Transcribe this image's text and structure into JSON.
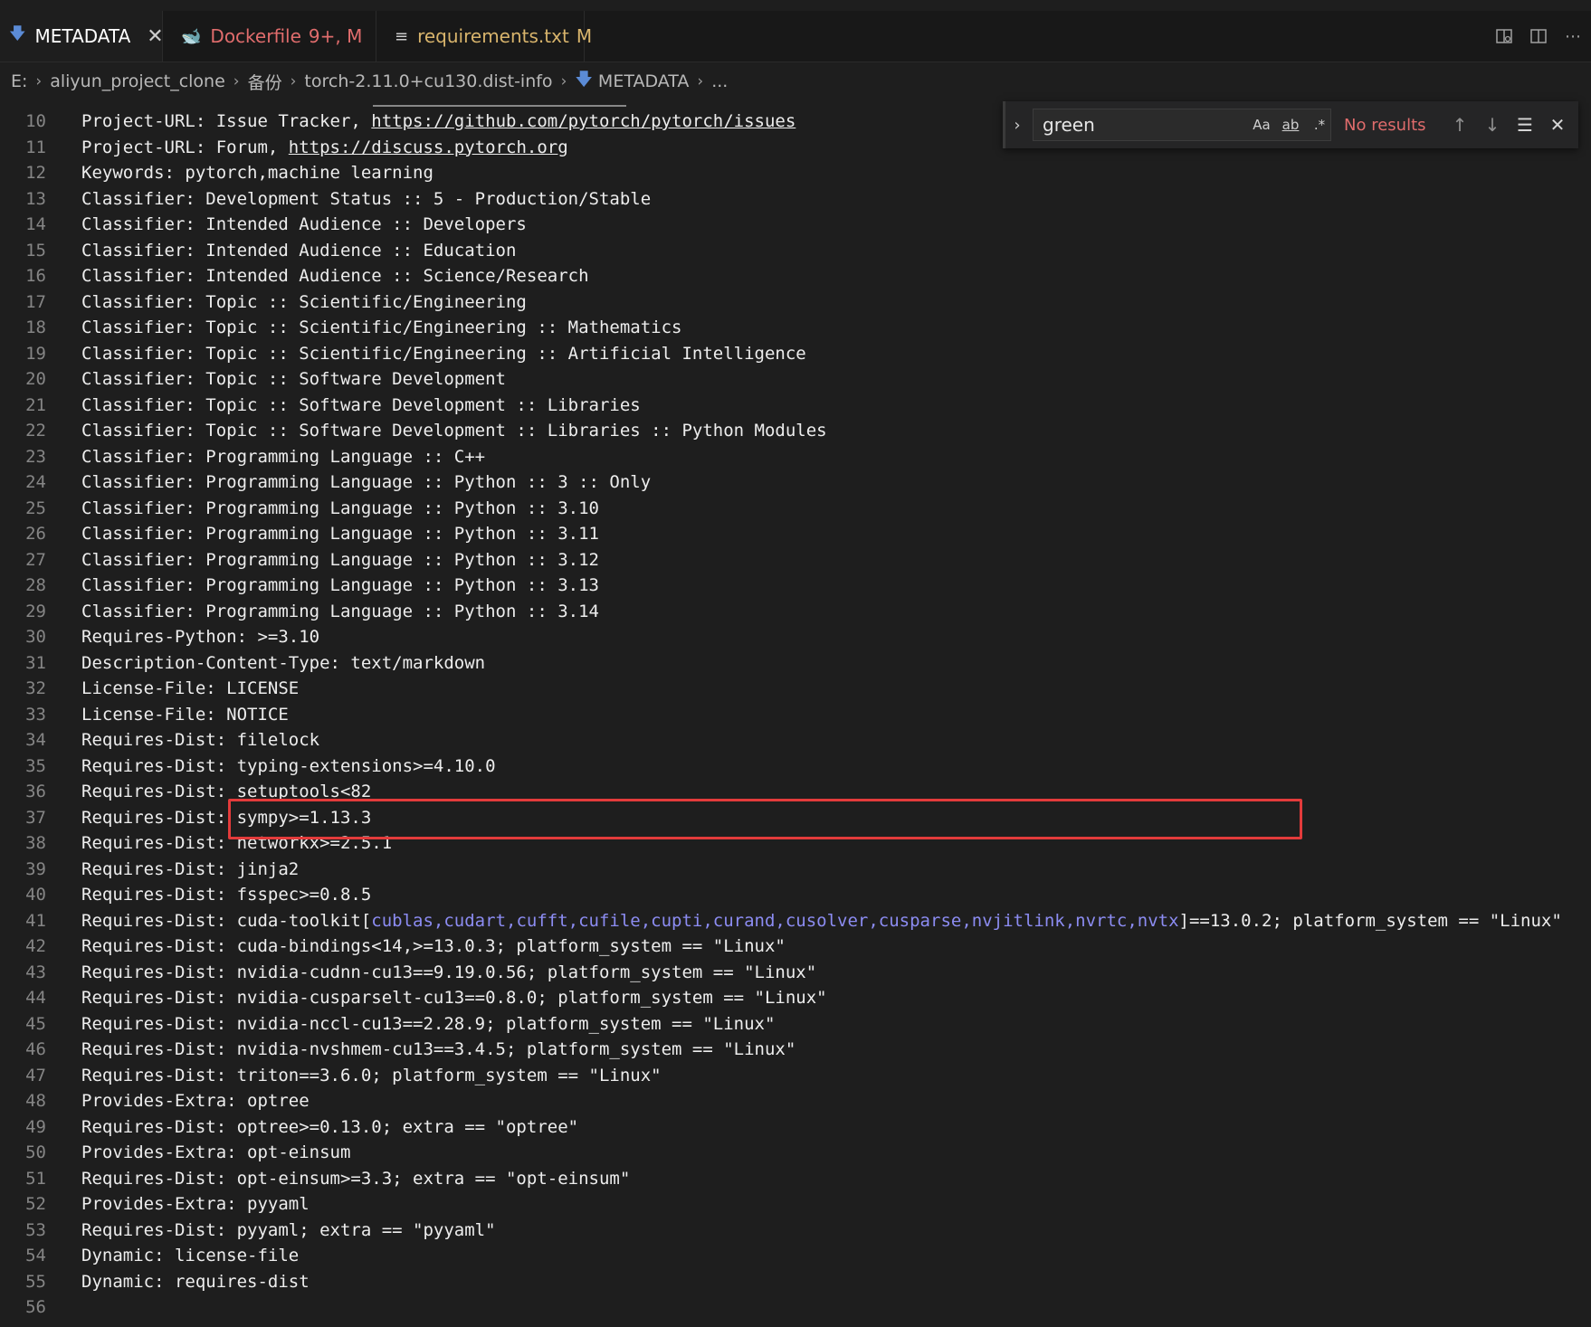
{
  "tabs": [
    {
      "label": "METADATA",
      "icon": "metadata-icon",
      "badge": "",
      "close": "✕"
    },
    {
      "label": "Dockerfile",
      "icon": "docker-icon",
      "badge": "9+, M",
      "close": ""
    },
    {
      "label": "requirements.txt",
      "icon": "text-file-icon",
      "badge": "M",
      "close": ""
    }
  ],
  "breadcrumb": [
    "E:",
    "aliyun_project_clone",
    "备份",
    "torch-2.11.0+cu130.dist-info",
    "METADATA",
    "..."
  ],
  "find": {
    "value": "green",
    "result": "No results",
    "match_case": "Aa",
    "whole_word": "ab",
    "regex": ".*"
  },
  "editor": {
    "lines": [
      {
        "n": "10",
        "parts": [
          {
            "t": "Project-URL: Issue Tracker, "
          },
          {
            "t": "https://github.com/pytorch/pytorch/issues",
            "c": "link"
          }
        ]
      },
      {
        "n": "11",
        "parts": [
          {
            "t": "Project-URL: Forum, "
          },
          {
            "t": "https://discuss.pytorch.org",
            "c": "link"
          }
        ]
      },
      {
        "n": "12",
        "parts": [
          {
            "t": "Keywords: pytorch,machine learning"
          }
        ]
      },
      {
        "n": "13",
        "parts": [
          {
            "t": "Classifier: Development Status :: 5 - Production/Stable"
          }
        ]
      },
      {
        "n": "14",
        "parts": [
          {
            "t": "Classifier: Intended Audience :: Developers"
          }
        ]
      },
      {
        "n": "15",
        "parts": [
          {
            "t": "Classifier: Intended Audience :: Education"
          }
        ]
      },
      {
        "n": "16",
        "parts": [
          {
            "t": "Classifier: Intended Audience :: Science/Research"
          }
        ]
      },
      {
        "n": "17",
        "parts": [
          {
            "t": "Classifier: Topic :: Scientific/Engineering"
          }
        ]
      },
      {
        "n": "18",
        "parts": [
          {
            "t": "Classifier: Topic :: Scientific/Engineering :: Mathematics"
          }
        ]
      },
      {
        "n": "19",
        "parts": [
          {
            "t": "Classifier: Topic :: Scientific/Engineering :: Artificial Intelligence"
          }
        ]
      },
      {
        "n": "20",
        "parts": [
          {
            "t": "Classifier: Topic :: Software Development"
          }
        ]
      },
      {
        "n": "21",
        "parts": [
          {
            "t": "Classifier: Topic :: Software Development :: Libraries"
          }
        ]
      },
      {
        "n": "22",
        "parts": [
          {
            "t": "Classifier: Topic :: Software Development :: Libraries :: Python Modules"
          }
        ]
      },
      {
        "n": "23",
        "parts": [
          {
            "t": "Classifier: Programming Language :: C++"
          }
        ]
      },
      {
        "n": "24",
        "parts": [
          {
            "t": "Classifier: Programming Language :: Python :: 3 :: Only"
          }
        ]
      },
      {
        "n": "25",
        "parts": [
          {
            "t": "Classifier: Programming Language :: Python :: 3.10"
          }
        ]
      },
      {
        "n": "26",
        "parts": [
          {
            "t": "Classifier: Programming Language :: Python :: 3.11"
          }
        ]
      },
      {
        "n": "27",
        "parts": [
          {
            "t": "Classifier: Programming Language :: Python :: 3.12"
          }
        ]
      },
      {
        "n": "28",
        "parts": [
          {
            "t": "Classifier: Programming Language :: Python :: 3.13"
          }
        ]
      },
      {
        "n": "29",
        "parts": [
          {
            "t": "Classifier: Programming Language :: Python :: 3.14"
          }
        ]
      },
      {
        "n": "30",
        "parts": [
          {
            "t": "Requires-Python: >=3.10"
          }
        ]
      },
      {
        "n": "31",
        "parts": [
          {
            "t": "Description-Content-Type: text/markdown"
          }
        ]
      },
      {
        "n": "32",
        "parts": [
          {
            "t": "License-File: LICENSE"
          }
        ]
      },
      {
        "n": "33",
        "parts": [
          {
            "t": "License-File: NOTICE"
          }
        ]
      },
      {
        "n": "34",
        "parts": [
          {
            "t": "Requires-Dist: filelock"
          }
        ]
      },
      {
        "n": "35",
        "parts": [
          {
            "t": "Requires-Dist: typing-extensions>=4.10.0"
          }
        ]
      },
      {
        "n": "36",
        "parts": [
          {
            "t": "Requires-Dist: setuptools<82"
          }
        ]
      },
      {
        "n": "37",
        "parts": [
          {
            "t": "Requires-Dist: sympy>=1.13.3"
          }
        ]
      },
      {
        "n": "38",
        "parts": [
          {
            "t": "Requires-Dist: networkx>=2.5.1"
          }
        ]
      },
      {
        "n": "39",
        "parts": [
          {
            "t": "Requires-Dist: jinja2"
          }
        ]
      },
      {
        "n": "40",
        "parts": [
          {
            "t": "Requires-Dist: fsspec>=0.8.5"
          }
        ]
      },
      {
        "n": "41",
        "parts": [
          {
            "t": "Requires-Dist: cuda-toolkit["
          },
          {
            "t": "cublas,cudart,cufft,cufile,cupti,curand,cusolver,cusparse,nvjitlink,nvrtc,nvtx",
            "c": "pkg"
          },
          {
            "t": "]==13.0.2; platform_system == \"Linux\""
          }
        ]
      },
      {
        "n": "42",
        "parts": [
          {
            "t": "Requires-Dist: cuda-bindings<14,>=13.0.3; platform_system == \"Linux\""
          }
        ]
      },
      {
        "n": "43",
        "parts": [
          {
            "t": "Requires-Dist: nvidia-cudnn-cu13==9.19.0.56; platform_system == \"Linux\""
          }
        ]
      },
      {
        "n": "44",
        "parts": [
          {
            "t": "Requires-Dist: nvidia-cusparselt-cu13==0.8.0; platform_system == \"Linux\""
          }
        ]
      },
      {
        "n": "45",
        "parts": [
          {
            "t": "Requires-Dist: nvidia-nccl-cu13==2.28.9; platform_system == \"Linux\""
          }
        ]
      },
      {
        "n": "46",
        "parts": [
          {
            "t": "Requires-Dist: nvidia-nvshmem-cu13==3.4.5; platform_system == \"Linux\""
          }
        ]
      },
      {
        "n": "47",
        "parts": [
          {
            "t": "Requires-Dist: triton==3.6.0; platform_system == \"Linux\""
          }
        ]
      },
      {
        "n": "48",
        "parts": [
          {
            "t": "Provides-Extra: optree"
          }
        ]
      },
      {
        "n": "49",
        "parts": [
          {
            "t": "Requires-Dist: optree>=0.13.0; extra == \"optree\""
          }
        ]
      },
      {
        "n": "50",
        "parts": [
          {
            "t": "Provides-Extra: opt-einsum"
          }
        ]
      },
      {
        "n": "51",
        "parts": [
          {
            "t": "Requires-Dist: opt-einsum>=3.3; extra == \"opt-einsum\""
          }
        ]
      },
      {
        "n": "52",
        "parts": [
          {
            "t": "Provides-Extra: pyyaml"
          }
        ]
      },
      {
        "n": "53",
        "parts": [
          {
            "t": "Requires-Dist: pyyaml; extra == \"pyyaml\""
          }
        ]
      },
      {
        "n": "54",
        "parts": [
          {
            "t": "Dynamic: license-file"
          }
        ]
      },
      {
        "n": "55",
        "parts": [
          {
            "t": "Dynamic: requires-dist"
          }
        ]
      },
      {
        "n": "56",
        "parts": [
          {
            "t": ""
          }
        ]
      }
    ]
  },
  "colors": {
    "background": "#1e1e1e",
    "highlight_border": "#e33b3b",
    "package_list": "#8c8cf2",
    "modified_tab_red": "#e06c6c",
    "modified_tab_yellow": "#d8b46c"
  }
}
